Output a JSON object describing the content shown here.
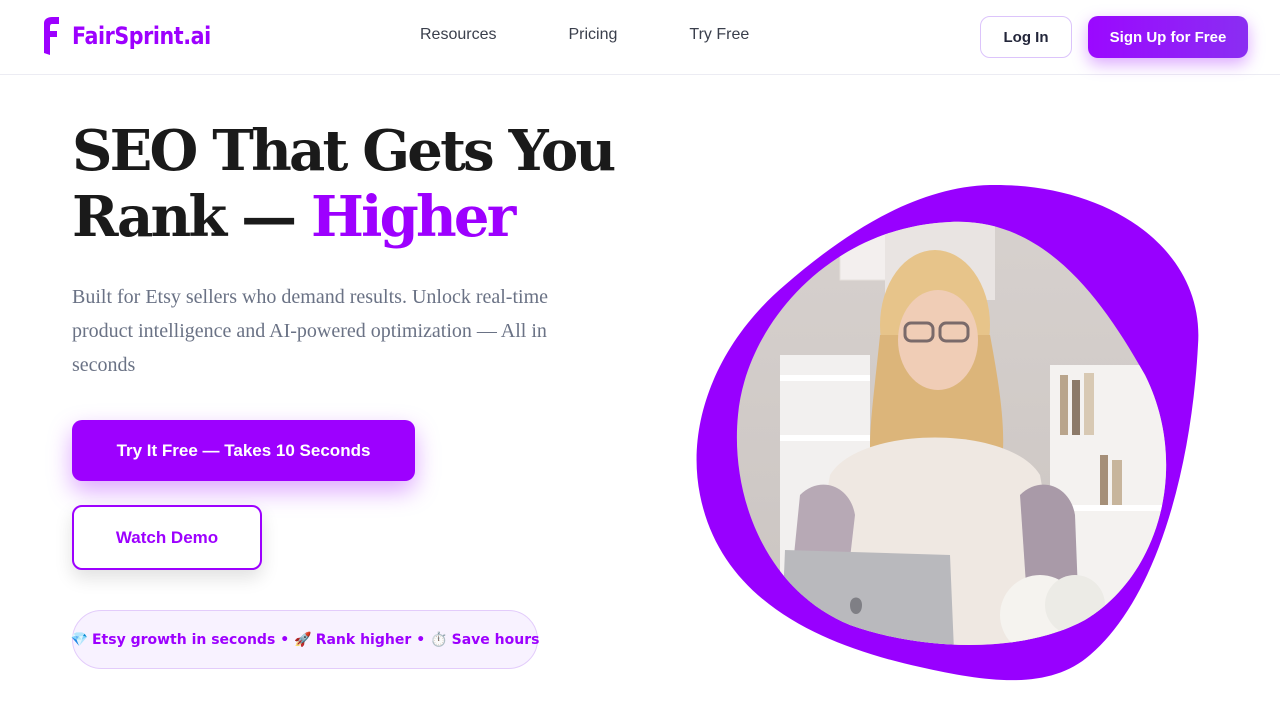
{
  "header": {
    "logo_text": "FairSprint.ai",
    "nav": [
      "Resources",
      "Pricing",
      "Try Free"
    ],
    "login_label": "Log In",
    "signup_label": "Sign Up for Free"
  },
  "hero": {
    "title_part1": "SEO That Gets You Rank — ",
    "title_accent": "Higher",
    "description": "Built for Etsy sellers who demand results. Unlock real-time product intelligence and AI-powered optimization — All in seconds",
    "primary_cta": "Try It Free — Takes 10 Seconds",
    "secondary_cta": "Watch Demo"
  },
  "badges": [
    {
      "icon": "💎",
      "icon_name": "gem-icon",
      "text": "Etsy growth in seconds"
    },
    {
      "icon": "🚀",
      "icon_name": "rocket-icon",
      "text": "Rank higher"
    },
    {
      "icon": "⏱️",
      "icon_name": "stopwatch-icon",
      "text": "Save hours"
    }
  ],
  "badge_separator": "•",
  "colors": {
    "brand": "#9d00ff",
    "text_dark": "#1a1a1a",
    "text_muted": "#6a7285",
    "pill_bg": "#f8f2ff"
  }
}
